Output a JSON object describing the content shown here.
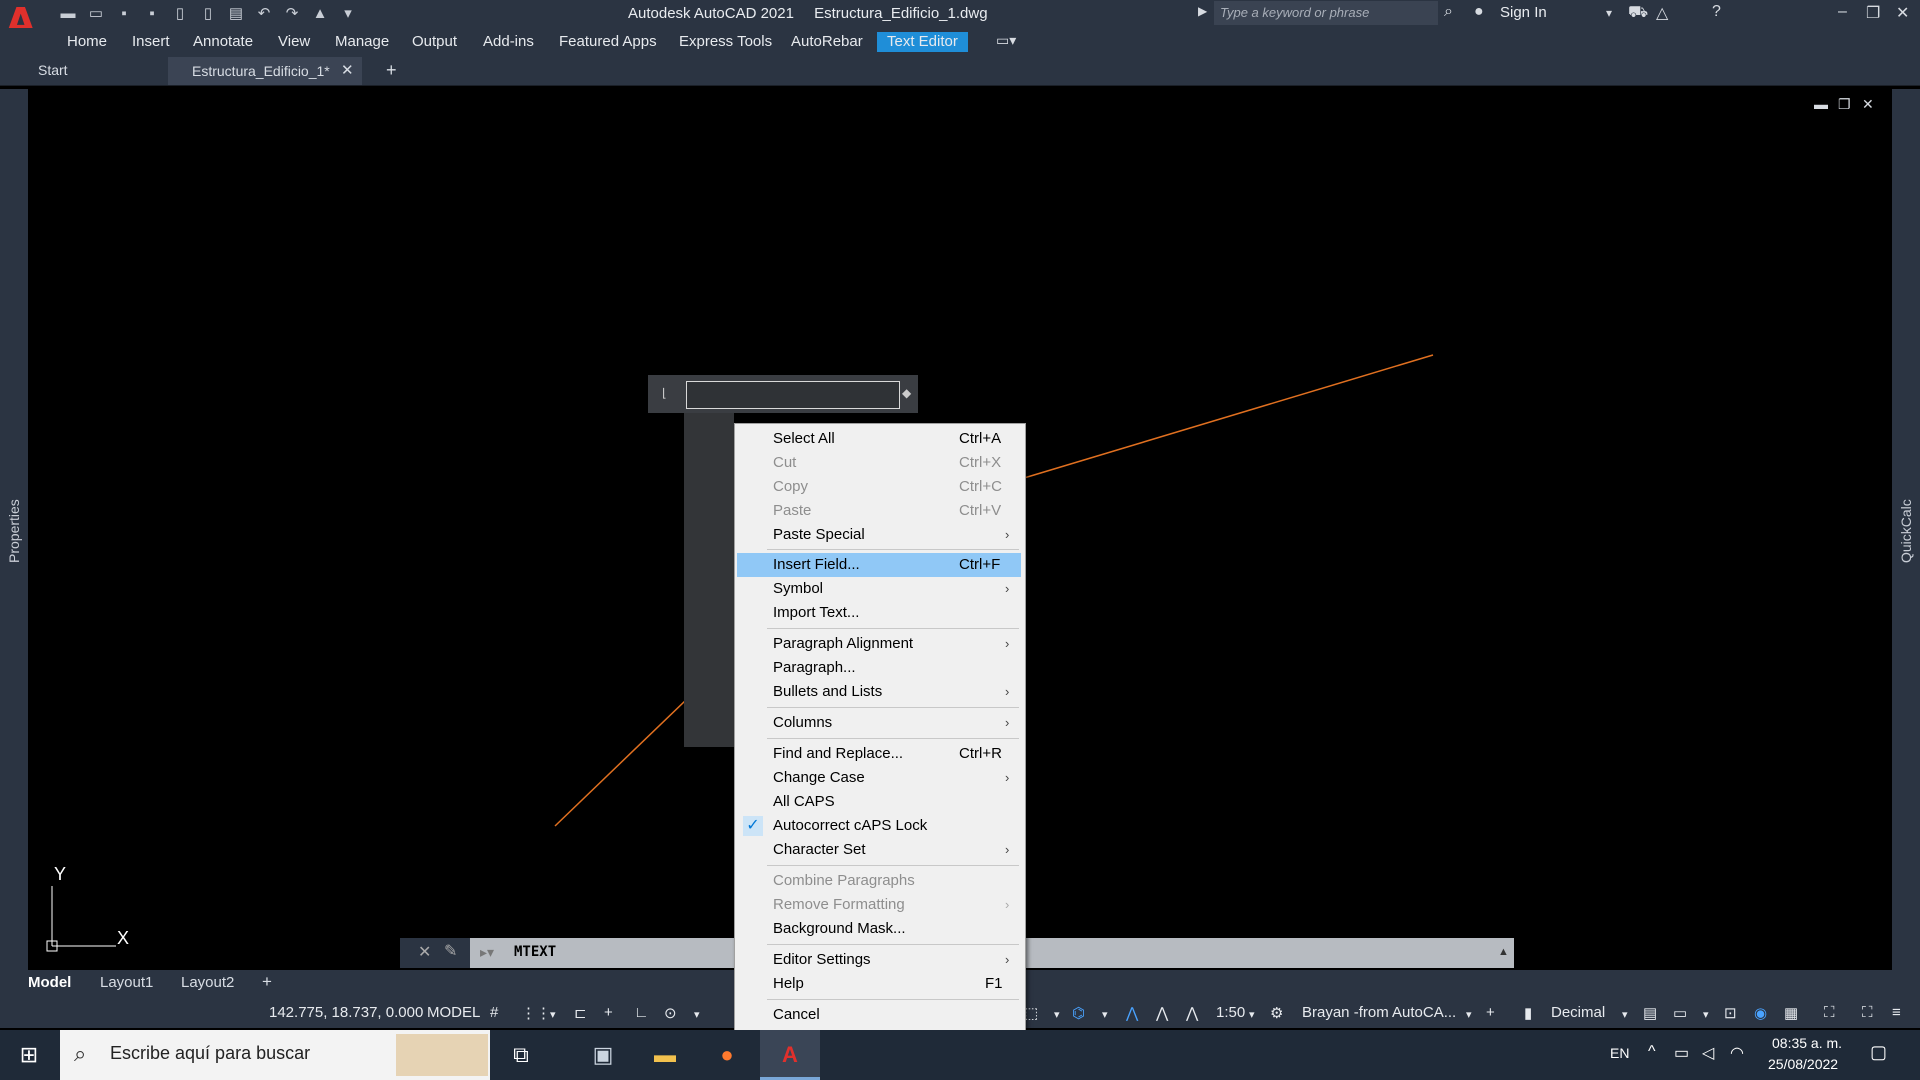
{
  "app": {
    "title": "Autodesk AutoCAD 2021",
    "file": "Estructura_Edificio_1.dwg",
    "logo": "A"
  },
  "header": {
    "search_placeholder": "Type a keyword or phrase",
    "sign_in": "Sign In"
  },
  "ribbon_tabs": [
    "Home",
    "Insert",
    "Annotate",
    "View",
    "Manage",
    "Output",
    "Add-ins",
    "Featured Apps",
    "Express Tools",
    "AutoRebar",
    "Text Editor"
  ],
  "doc_tabs": {
    "start": "Start",
    "active": "Estructura_Edificio_1*"
  },
  "side": {
    "left": "Properties",
    "right": "QuickCalc"
  },
  "ucs": {
    "y": "Y",
    "x": "X"
  },
  "command": {
    "text": "MTEXT"
  },
  "context_menu": {
    "items": [
      {
        "label": "Select All",
        "shortcut": "Ctrl+A"
      },
      {
        "label": "Cut",
        "shortcut": "Ctrl+X",
        "disabled": true
      },
      {
        "label": "Copy",
        "shortcut": "Ctrl+C",
        "disabled": true
      },
      {
        "label": "Paste",
        "shortcut": "Ctrl+V",
        "disabled": true
      },
      {
        "label": "Paste Special",
        "submenu": true
      },
      {
        "label": "Insert Field...",
        "shortcut": "Ctrl+F",
        "highlighted": true
      },
      {
        "label": "Symbol",
        "submenu": true
      },
      {
        "label": "Import Text..."
      },
      {
        "label": "Paragraph Alignment",
        "submenu": true
      },
      {
        "label": "Paragraph..."
      },
      {
        "label": "Bullets and Lists",
        "submenu": true
      },
      {
        "label": "Columns",
        "submenu": true
      },
      {
        "label": "Find and Replace...",
        "shortcut": "Ctrl+R"
      },
      {
        "label": "Change Case",
        "submenu": true
      },
      {
        "label": "All CAPS"
      },
      {
        "label": "Autocorrect cAPS Lock",
        "checked": true
      },
      {
        "label": "Character Set",
        "submenu": true
      },
      {
        "label": "Combine Paragraphs",
        "disabled": true
      },
      {
        "label": "Remove Formatting",
        "disabled": true,
        "submenu": true
      },
      {
        "label": "Background Mask..."
      },
      {
        "label": "Editor Settings",
        "submenu": true
      },
      {
        "label": "Help",
        "shortcut": "F1"
      },
      {
        "label": "Cancel"
      }
    ]
  },
  "layouts": [
    "Model",
    "Layout1",
    "Layout2"
  ],
  "status": {
    "coords": "142.775, 18.737, 0.000",
    "mode": "MODEL",
    "scale": "1:50",
    "workspace": "Brayan -from AutoCA...",
    "units": "Decimal"
  },
  "taskbar": {
    "search": "Escribe aquí para buscar",
    "lang": "EN",
    "time": "08:35 a. m.",
    "date": "25/08/2022"
  },
  "colors": {
    "accent": "#1f8ed8",
    "line": "#e07020",
    "chrome": "#2b3442"
  }
}
